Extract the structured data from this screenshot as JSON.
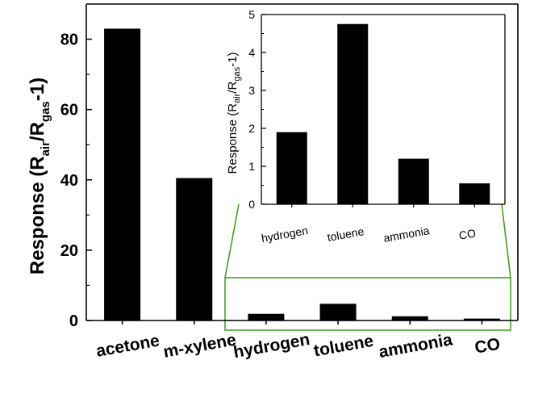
{
  "chart_data": [
    {
      "type": "bar",
      "categories": [
        "acetone",
        "m-xylene",
        "hydrogen",
        "toluene",
        "ammonia",
        "CO"
      ],
      "values": [
        83,
        40.5,
        1.9,
        4.75,
        1.2,
        0.55
      ],
      "ylabel": {
        "base": "Response (R",
        "sub1": "air",
        "mid": "/R",
        "sub2": "gas",
        "end": "-1)"
      },
      "ylim": [
        0,
        90
      ],
      "yticks": [
        0,
        20,
        40,
        60,
        80
      ],
      "grid": false,
      "colors": {
        "bar": "#000000",
        "zoom_box": "#3a9a1a"
      }
    },
    {
      "type": "bar",
      "categories": [
        "hydrogen",
        "toluene",
        "ammonia",
        "CO"
      ],
      "values": [
        1.9,
        4.75,
        1.2,
        0.55
      ],
      "ylabel": {
        "base": "Response (R",
        "sub1": "air",
        "mid": "/R",
        "sub2": "gas",
        "end": "-1)"
      },
      "ylim": [
        0,
        5
      ],
      "yticks": [
        0,
        1,
        2,
        3,
        4,
        5
      ],
      "grid": false,
      "colors": {
        "bar": "#000000"
      }
    }
  ]
}
